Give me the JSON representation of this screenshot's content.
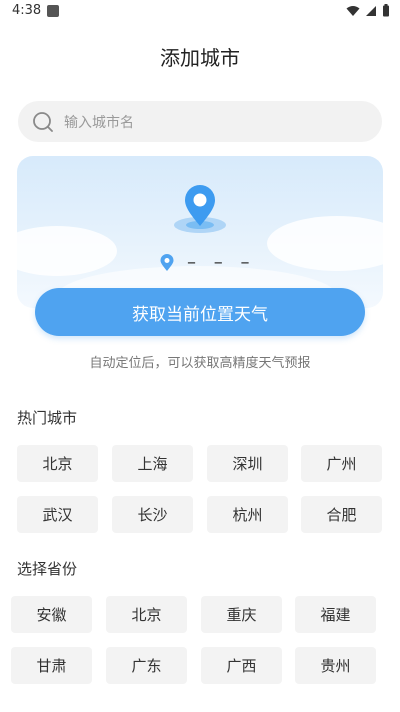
{
  "status": {
    "time": "4:38"
  },
  "header": {
    "title": "添加城市"
  },
  "search": {
    "placeholder": "输入城市名"
  },
  "location": {
    "value": "– – –"
  },
  "locate": {
    "button_label": "获取当前位置天气",
    "hint": "自动定位后，可以获取高精度天气预报"
  },
  "hot_cities": {
    "title": "热门城市",
    "items": [
      "北京",
      "上海",
      "深圳",
      "广州",
      "武汉",
      "长沙",
      "杭州",
      "合肥"
    ]
  },
  "provinces": {
    "title": "选择省份",
    "items": [
      "安徽",
      "北京",
      "重庆",
      "福建",
      "甘肃",
      "广东",
      "广西",
      "贵州"
    ]
  },
  "colors": {
    "accent": "#4fa3f0",
    "chip_bg": "#f3f3f3"
  }
}
